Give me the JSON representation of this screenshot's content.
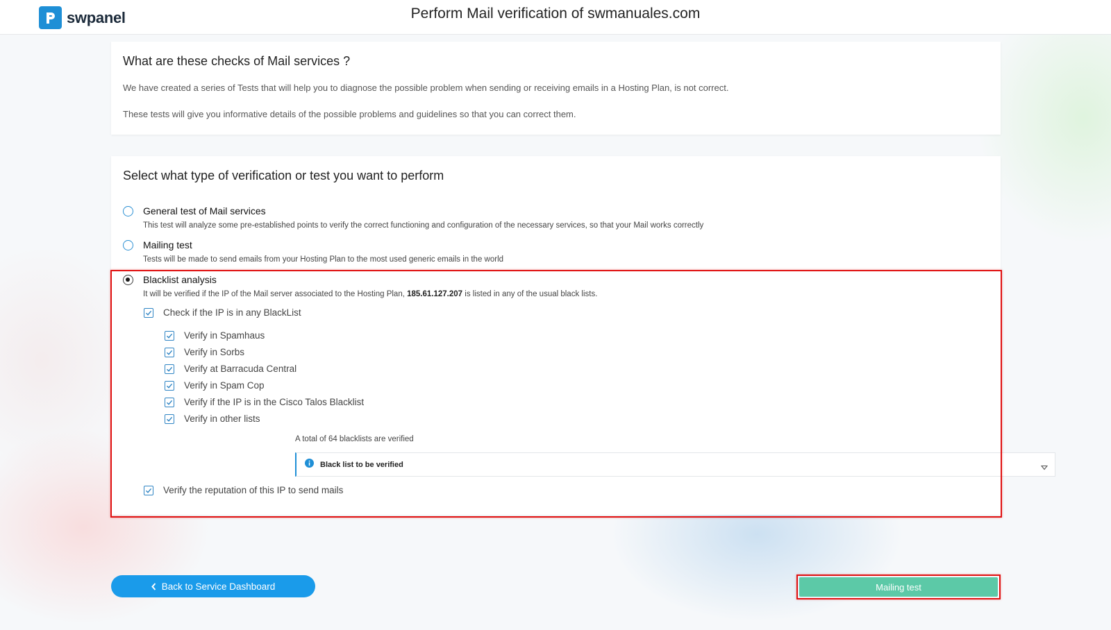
{
  "header": {
    "logo_text": "swpanel",
    "title": "Perform Mail verification of swmanuales.com"
  },
  "info_card": {
    "heading": "What are these checks of Mail services ?",
    "paragraph1": "We have created a series of Tests that will help you to diagnose the possible problem when sending or receiving emails in a Hosting Plan, is not correct.",
    "paragraph2": "These tests will give you informative details of the possible problems and guidelines so that you can correct them."
  },
  "select_card": {
    "heading": "Select what type of verification or test you want to perform",
    "options": [
      {
        "label": "General test of Mail services",
        "description": "This test will analyze some pre-established points to verify the correct functioning and configuration of the necessary services, so that your Mail works correctly",
        "selected": false
      },
      {
        "label": "Mailing test",
        "description": "Tests will be made to send emails from your Hosting Plan to the most used generic emails in the world",
        "selected": false
      },
      {
        "label": "Blacklist analysis",
        "description_before": "It will be verified if the IP of the Mail server associated to the Hosting Plan,",
        "ip": "185.61.127.207",
        "description_after": "is listed in any of the usual black lists.",
        "selected": true
      }
    ],
    "check_blacklist": {
      "label": "Check if the IP is in any BlackList",
      "checked": true
    },
    "sub_checks": [
      {
        "label": "Verify in Spamhaus",
        "checked": true
      },
      {
        "label": "Verify in Sorbs",
        "checked": true
      },
      {
        "label": "Verify at Barracuda Central",
        "checked": true
      },
      {
        "label": "Verify in Spam Cop",
        "checked": true
      },
      {
        "label": "Verify if the IP is in the Cisco Talos Blacklist",
        "checked": true
      },
      {
        "label": "Verify in other lists",
        "checked": true
      }
    ],
    "total_note": "A total of 64 blacklists are verified",
    "dropdown_label": "Black list to be verified",
    "reputation_check": {
      "label": "Verify the reputation of this IP to send mails",
      "checked": true
    }
  },
  "buttons": {
    "back": "Back to Service Dashboard",
    "mailing_test": "Mailing test"
  },
  "colors": {
    "primary_blue": "#1a9bea",
    "submit_green": "#5cc9a7",
    "highlight_red": "#e01010"
  }
}
